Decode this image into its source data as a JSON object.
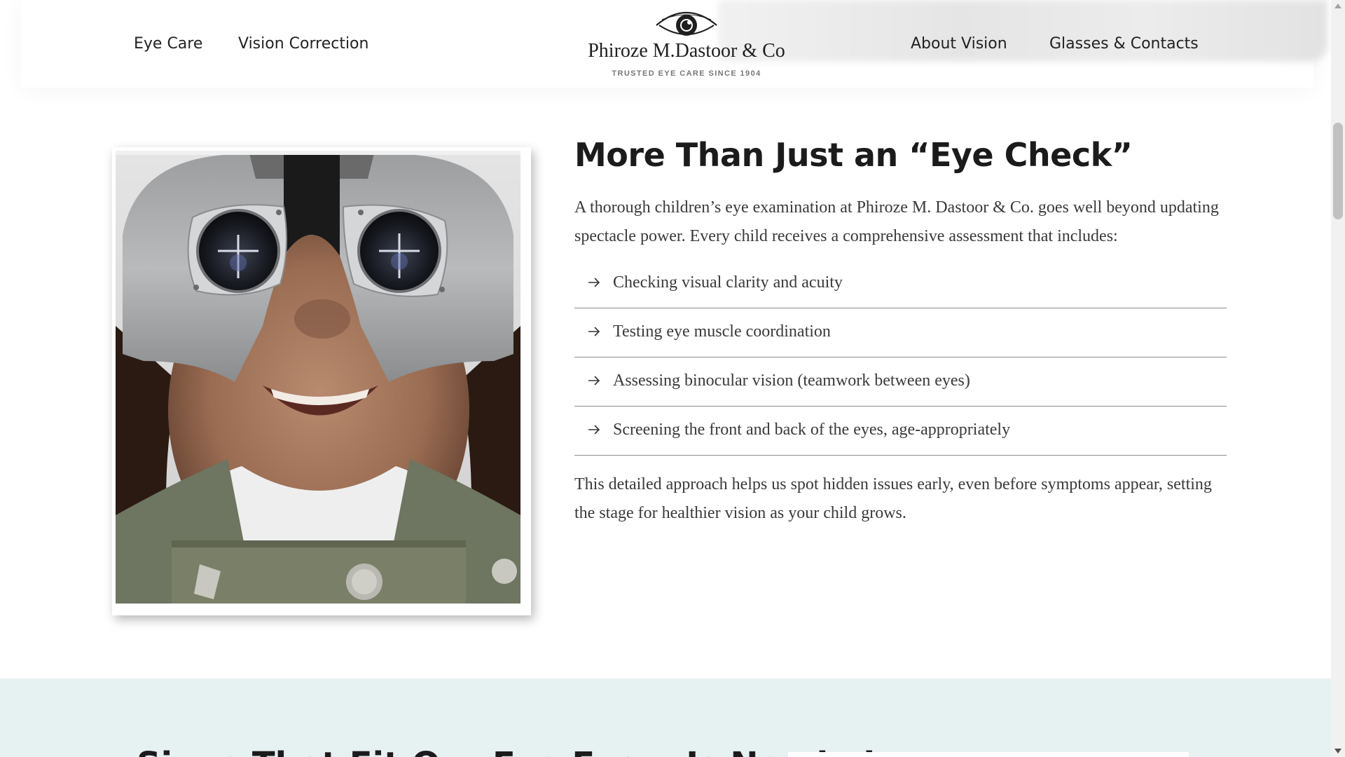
{
  "header": {
    "nav_left": [
      "Eye Care",
      "Vision Correction"
    ],
    "nav_right": [
      "About Vision",
      "Glasses & Contacts"
    ],
    "logo": {
      "name": "Phiroze M.Dastoor & Co",
      "tagline": "TRUSTED EYE CARE SINCE 1904",
      "icon": "eye-logo-icon"
    }
  },
  "main": {
    "image": {
      "icon": "child-eye-exam-photo"
    },
    "heading": "More Than Just an “Eye Check”",
    "intro": "A thorough children’s eye examination at Phiroze M. Dastoor & Co. goes well beyond updating spectacle power. Every child receives a comprehensive assessment that includes:",
    "checklist": [
      "Checking visual clarity and acuity",
      "Testing eye muscle coordination",
      "Assessing binocular vision (teamwork between eyes)",
      "Screening the front and back of the eyes, age-appropriately"
    ],
    "outro": "This detailed approach helps us spot hidden issues early, even before symptoms appear, setting the stage for healthier vision as your child grows."
  },
  "next_section": {
    "heading": "Signs That Fit Our Eye Exam Is Needed",
    "background": "#e6f2f1"
  },
  "colors": {
    "text": "#3a3a3a",
    "heading": "#1b1b1b",
    "divider": "#8c8c8c",
    "section_tint": "#e6f2f1"
  }
}
